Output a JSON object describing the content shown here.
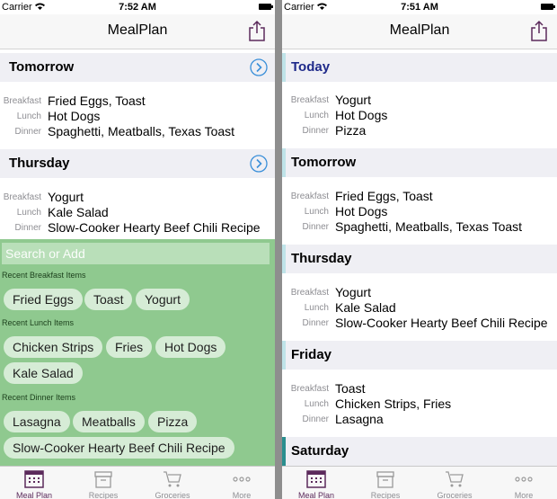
{
  "left": {
    "status": {
      "carrier": "Carrier",
      "time": "7:52 AM"
    },
    "nav": {
      "title": "MealPlan",
      "share_icon": "share-icon"
    },
    "days": [
      {
        "label": "Tomorrow",
        "meals": {
          "breakfast": "Fried Eggs, Toast",
          "lunch": "Hot Dogs",
          "dinner": "Spaghetti, Meatballs, Texas Toast"
        }
      },
      {
        "label": "Thursday",
        "meals": {
          "breakfast": "Yogurt",
          "lunch": "Kale Salad",
          "dinner": "Slow-Cooker Hearty Beef Chili Recipe"
        }
      }
    ],
    "add_panel": {
      "search_placeholder": "Search or Add",
      "breakfast_title": "Recent Breakfast Items",
      "breakfast_items": [
        "Fried Eggs",
        "Toast",
        "Yogurt"
      ],
      "lunch_title": "Recent Lunch Items",
      "lunch_items": [
        "Chicken Strips",
        "Fries",
        "Hot Dogs",
        "Kale Salad"
      ],
      "dinner_title": "Recent Dinner Items",
      "dinner_items": [
        "Lasagna",
        "Meatballs",
        "Pizza",
        "Slow-Cooker Hearty Beef Chili Recipe"
      ]
    }
  },
  "right": {
    "status": {
      "carrier": "Carrier",
      "time": "7:51 AM"
    },
    "nav": {
      "title": "MealPlan",
      "share_icon": "share-icon"
    },
    "days": [
      {
        "label": "Today",
        "meals": {
          "breakfast": "Yogurt",
          "lunch": "Hot Dogs",
          "dinner": "Pizza"
        }
      },
      {
        "label": "Tomorrow",
        "meals": {
          "breakfast": "Fried Eggs, Toast",
          "lunch": "Hot Dogs",
          "dinner": "Spaghetti, Meatballs, Texas Toast"
        }
      },
      {
        "label": "Thursday",
        "meals": {
          "breakfast": "Yogurt",
          "lunch": "Kale Salad",
          "dinner": "Slow-Cooker Hearty Beef Chili Recipe"
        }
      },
      {
        "label": "Friday",
        "meals": {
          "breakfast": "Toast",
          "lunch": "Chicken Strips, Fries",
          "dinner": "Lasagna"
        }
      },
      {
        "label": "Saturday"
      }
    ]
  },
  "meal_labels": {
    "breakfast": "Breakfast",
    "lunch": "Lunch",
    "dinner": "Dinner"
  },
  "tabs": [
    {
      "label": "Meal Plan",
      "icon": "calendar-icon",
      "active": true
    },
    {
      "label": "Recipes",
      "icon": "recipe-box-icon",
      "active": false
    },
    {
      "label": "Groceries",
      "icon": "cart-icon",
      "active": false
    },
    {
      "label": "More",
      "icon": "more-icon",
      "active": false
    }
  ],
  "colors": {
    "accent_purple": "#5b2a5b",
    "today_text": "#1f2a8a",
    "chevron_blue": "#3a8fd9",
    "panel_green": "#8fc98f",
    "chip_green": "#d6ecd6",
    "header_gray": "#efeff4",
    "accent_light": "#bfe3e8",
    "accent_dark": "#2a8f8f"
  }
}
